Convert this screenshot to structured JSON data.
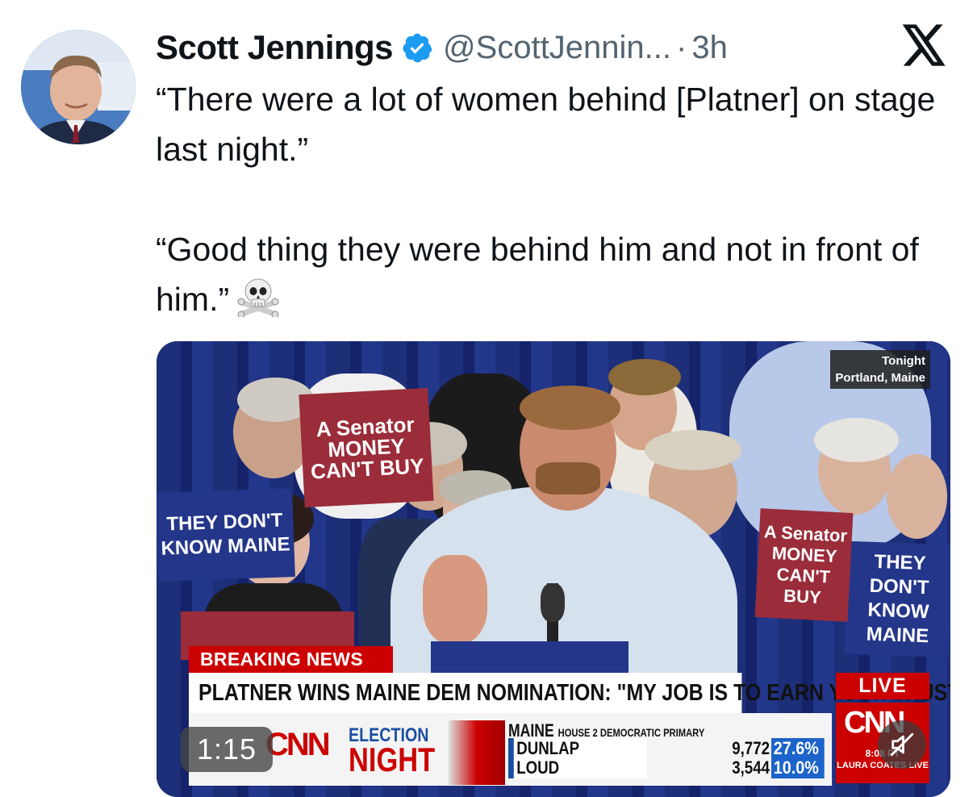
{
  "author": {
    "name": "Scott Jennings",
    "handle": "@ScottJennin...",
    "separator": "·",
    "time": "3h"
  },
  "tweet": {
    "paragraph1": "“There were a lot of women behind [Platner] on stage last night.”",
    "paragraph2": "“Good thing they were behind him and not in front of him.”"
  },
  "icons": {
    "verified": "verified-badge-icon",
    "platform": "x-logo-icon",
    "emoji": "skull-crossbones-icon",
    "mute": "mute-icon"
  },
  "video": {
    "location_line1": "Tonight",
    "location_line2": "Portland, Maine",
    "breaking": "BREAKING NEWS",
    "headline": "PLATNER WINS MAINE DEM NOMINATION: \"MY JOB IS TO EARN YOUR TRUST\"",
    "live": "LIVE",
    "network": "CNN",
    "election_line1": "ELECTION",
    "election_line2": "NIGHT",
    "race_state": "MAINE",
    "race_name": "HOUSE 2 DEMOCRATIC PRIMARY",
    "results": [
      {
        "candidate": "DUNLAP",
        "votes": "9,772",
        "pct": "27.6%"
      },
      {
        "candidate": "LOUD",
        "votes": "3,544",
        "pct": "10.0%"
      }
    ],
    "time_slot": "8:08 PT",
    "show": "LAURA COATES LIVE",
    "timer": "1:15",
    "sign_texts": [
      "A Senator MONEY CAN'T BUY",
      "THEY DON'T KNOW MAINE",
      "THEY DON'T KNOW MAINE",
      "A Senator MONEY CAN'T BUY"
    ]
  },
  "colors": {
    "text": "#0f1419",
    "secondary": "#536471",
    "verified": "#1d9bf0",
    "cnn_red": "#cc0000"
  }
}
